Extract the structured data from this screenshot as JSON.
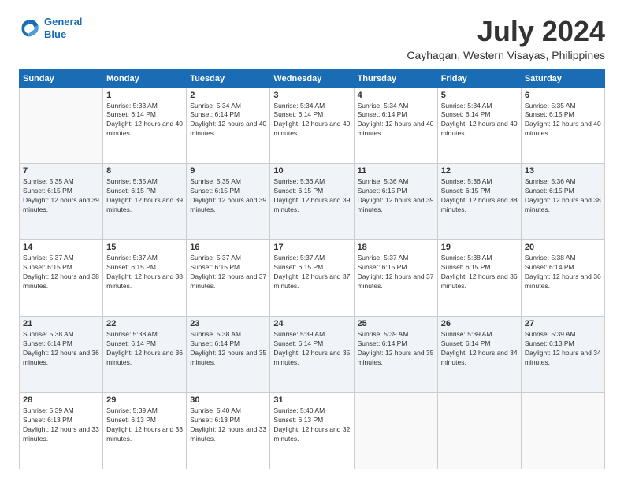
{
  "logo": {
    "line1": "General",
    "line2": "Blue"
  },
  "title": "July 2024",
  "subtitle": "Cayhagan, Western Visayas, Philippines",
  "weekdays": [
    "Sunday",
    "Monday",
    "Tuesday",
    "Wednesday",
    "Thursday",
    "Friday",
    "Saturday"
  ],
  "weeks": [
    [
      {
        "day": "",
        "sunrise": "",
        "sunset": "",
        "daylight": ""
      },
      {
        "day": "1",
        "sunrise": "Sunrise: 5:33 AM",
        "sunset": "Sunset: 6:14 PM",
        "daylight": "Daylight: 12 hours and 40 minutes."
      },
      {
        "day": "2",
        "sunrise": "Sunrise: 5:34 AM",
        "sunset": "Sunset: 6:14 PM",
        "daylight": "Daylight: 12 hours and 40 minutes."
      },
      {
        "day": "3",
        "sunrise": "Sunrise: 5:34 AM",
        "sunset": "Sunset: 6:14 PM",
        "daylight": "Daylight: 12 hours and 40 minutes."
      },
      {
        "day": "4",
        "sunrise": "Sunrise: 5:34 AM",
        "sunset": "Sunset: 6:14 PM",
        "daylight": "Daylight: 12 hours and 40 minutes."
      },
      {
        "day": "5",
        "sunrise": "Sunrise: 5:34 AM",
        "sunset": "Sunset: 6:14 PM",
        "daylight": "Daylight: 12 hours and 40 minutes."
      },
      {
        "day": "6",
        "sunrise": "Sunrise: 5:35 AM",
        "sunset": "Sunset: 6:15 PM",
        "daylight": "Daylight: 12 hours and 40 minutes."
      }
    ],
    [
      {
        "day": "7",
        "sunrise": "Sunrise: 5:35 AM",
        "sunset": "Sunset: 6:15 PM",
        "daylight": "Daylight: 12 hours and 39 minutes."
      },
      {
        "day": "8",
        "sunrise": "Sunrise: 5:35 AM",
        "sunset": "Sunset: 6:15 PM",
        "daylight": "Daylight: 12 hours and 39 minutes."
      },
      {
        "day": "9",
        "sunrise": "Sunrise: 5:35 AM",
        "sunset": "Sunset: 6:15 PM",
        "daylight": "Daylight: 12 hours and 39 minutes."
      },
      {
        "day": "10",
        "sunrise": "Sunrise: 5:36 AM",
        "sunset": "Sunset: 6:15 PM",
        "daylight": "Daylight: 12 hours and 39 minutes."
      },
      {
        "day": "11",
        "sunrise": "Sunrise: 5:36 AM",
        "sunset": "Sunset: 6:15 PM",
        "daylight": "Daylight: 12 hours and 39 minutes."
      },
      {
        "day": "12",
        "sunrise": "Sunrise: 5:36 AM",
        "sunset": "Sunset: 6:15 PM",
        "daylight": "Daylight: 12 hours and 38 minutes."
      },
      {
        "day": "13",
        "sunrise": "Sunrise: 5:36 AM",
        "sunset": "Sunset: 6:15 PM",
        "daylight": "Daylight: 12 hours and 38 minutes."
      }
    ],
    [
      {
        "day": "14",
        "sunrise": "Sunrise: 5:37 AM",
        "sunset": "Sunset: 6:15 PM",
        "daylight": "Daylight: 12 hours and 38 minutes."
      },
      {
        "day": "15",
        "sunrise": "Sunrise: 5:37 AM",
        "sunset": "Sunset: 6:15 PM",
        "daylight": "Daylight: 12 hours and 38 minutes."
      },
      {
        "day": "16",
        "sunrise": "Sunrise: 5:37 AM",
        "sunset": "Sunset: 6:15 PM",
        "daylight": "Daylight: 12 hours and 37 minutes."
      },
      {
        "day": "17",
        "sunrise": "Sunrise: 5:37 AM",
        "sunset": "Sunset: 6:15 PM",
        "daylight": "Daylight: 12 hours and 37 minutes."
      },
      {
        "day": "18",
        "sunrise": "Sunrise: 5:37 AM",
        "sunset": "Sunset: 6:15 PM",
        "daylight": "Daylight: 12 hours and 37 minutes."
      },
      {
        "day": "19",
        "sunrise": "Sunrise: 5:38 AM",
        "sunset": "Sunset: 6:15 PM",
        "daylight": "Daylight: 12 hours and 36 minutes."
      },
      {
        "day": "20",
        "sunrise": "Sunrise: 5:38 AM",
        "sunset": "Sunset: 6:14 PM",
        "daylight": "Daylight: 12 hours and 36 minutes."
      }
    ],
    [
      {
        "day": "21",
        "sunrise": "Sunrise: 5:38 AM",
        "sunset": "Sunset: 6:14 PM",
        "daylight": "Daylight: 12 hours and 36 minutes."
      },
      {
        "day": "22",
        "sunrise": "Sunrise: 5:38 AM",
        "sunset": "Sunset: 6:14 PM",
        "daylight": "Daylight: 12 hours and 36 minutes."
      },
      {
        "day": "23",
        "sunrise": "Sunrise: 5:38 AM",
        "sunset": "Sunset: 6:14 PM",
        "daylight": "Daylight: 12 hours and 35 minutes."
      },
      {
        "day": "24",
        "sunrise": "Sunrise: 5:39 AM",
        "sunset": "Sunset: 6:14 PM",
        "daylight": "Daylight: 12 hours and 35 minutes."
      },
      {
        "day": "25",
        "sunrise": "Sunrise: 5:39 AM",
        "sunset": "Sunset: 6:14 PM",
        "daylight": "Daylight: 12 hours and 35 minutes."
      },
      {
        "day": "26",
        "sunrise": "Sunrise: 5:39 AM",
        "sunset": "Sunset: 6:14 PM",
        "daylight": "Daylight: 12 hours and 34 minutes."
      },
      {
        "day": "27",
        "sunrise": "Sunrise: 5:39 AM",
        "sunset": "Sunset: 6:13 PM",
        "daylight": "Daylight: 12 hours and 34 minutes."
      }
    ],
    [
      {
        "day": "28",
        "sunrise": "Sunrise: 5:39 AM",
        "sunset": "Sunset: 6:13 PM",
        "daylight": "Daylight: 12 hours and 33 minutes."
      },
      {
        "day": "29",
        "sunrise": "Sunrise: 5:39 AM",
        "sunset": "Sunset: 6:13 PM",
        "daylight": "Daylight: 12 hours and 33 minutes."
      },
      {
        "day": "30",
        "sunrise": "Sunrise: 5:40 AM",
        "sunset": "Sunset: 6:13 PM",
        "daylight": "Daylight: 12 hours and 33 minutes."
      },
      {
        "day": "31",
        "sunrise": "Sunrise: 5:40 AM",
        "sunset": "Sunset: 6:13 PM",
        "daylight": "Daylight: 12 hours and 32 minutes."
      },
      {
        "day": "",
        "sunrise": "",
        "sunset": "",
        "daylight": ""
      },
      {
        "day": "",
        "sunrise": "",
        "sunset": "",
        "daylight": ""
      },
      {
        "day": "",
        "sunrise": "",
        "sunset": "",
        "daylight": ""
      }
    ]
  ]
}
